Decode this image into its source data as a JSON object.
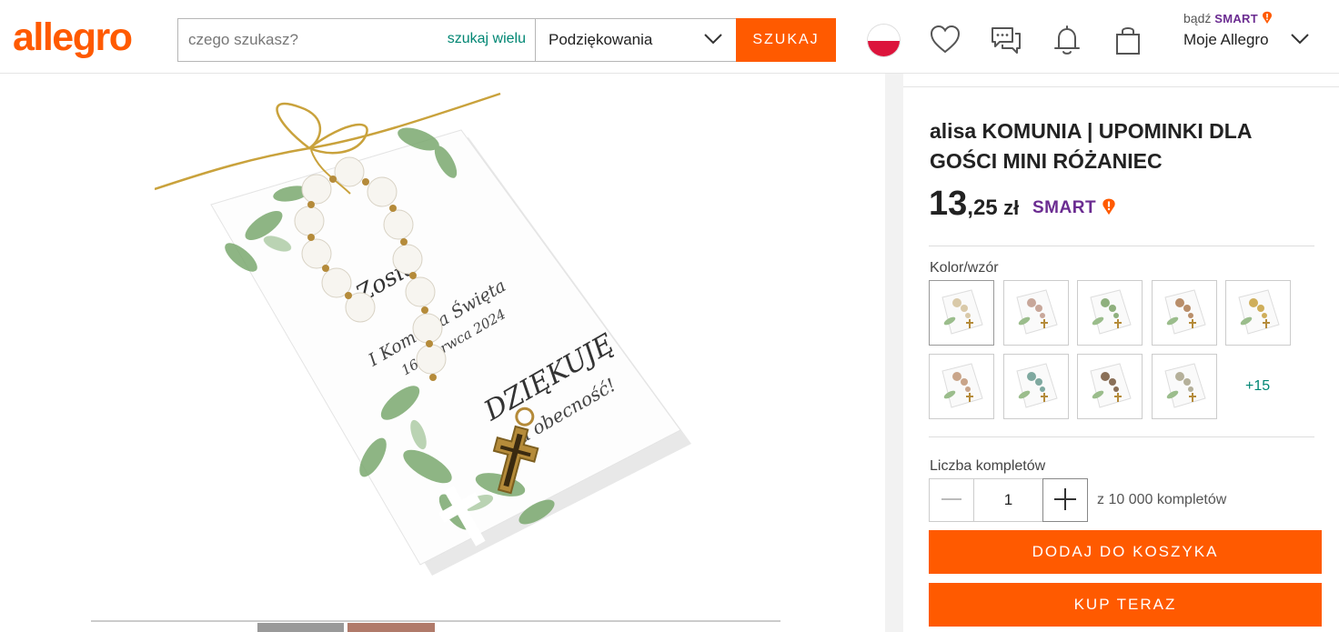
{
  "brand": {
    "logo_text": "allegro",
    "color": "#ff5a00"
  },
  "search": {
    "placeholder": "czego szukasz?",
    "multi_label": "szukaj wielu",
    "category_value": "Podziękowania",
    "button_label": "SZUKAJ"
  },
  "header": {
    "smart_prefix": "bądź",
    "smart_word": "SMART",
    "account_label": "Moje Allegro",
    "icons": [
      "poland-flag-icon",
      "heart-icon",
      "messages-icon",
      "bell-icon",
      "cart-bag-icon",
      "chevron-down-icon"
    ]
  },
  "gallery": {
    "image_alt": "Komunia – mini różaniec na karteczce „Dziękuję za obecność!”",
    "card_text": {
      "name": "Zosia",
      "event": "I Komunia Święta",
      "date": "16 czerwca 2024",
      "thanks": "DZIĘKUJĘ",
      "presence": "za obecność!"
    }
  },
  "product": {
    "title": "alisa KOMUNIA | UPOMINKI DLA GOŚCI MINI RÓŻANIEC",
    "price_main": "13",
    "price_cents": ",25",
    "currency": "zł",
    "smart_badge": "SMART",
    "variant_label": "Kolor/wzór",
    "variant_count": 9,
    "variants_more": "+15",
    "quantity_label": "Liczba kompletów",
    "quantity_value": "1",
    "quantity_of": "z 10 000 kompletów",
    "add_to_cart": "DODAJ DO KOSZYKA",
    "buy_now": "KUP TERAZ"
  },
  "colors": {
    "accent": "#ff5a00",
    "link": "#008673",
    "smart": "#6b2c91"
  }
}
